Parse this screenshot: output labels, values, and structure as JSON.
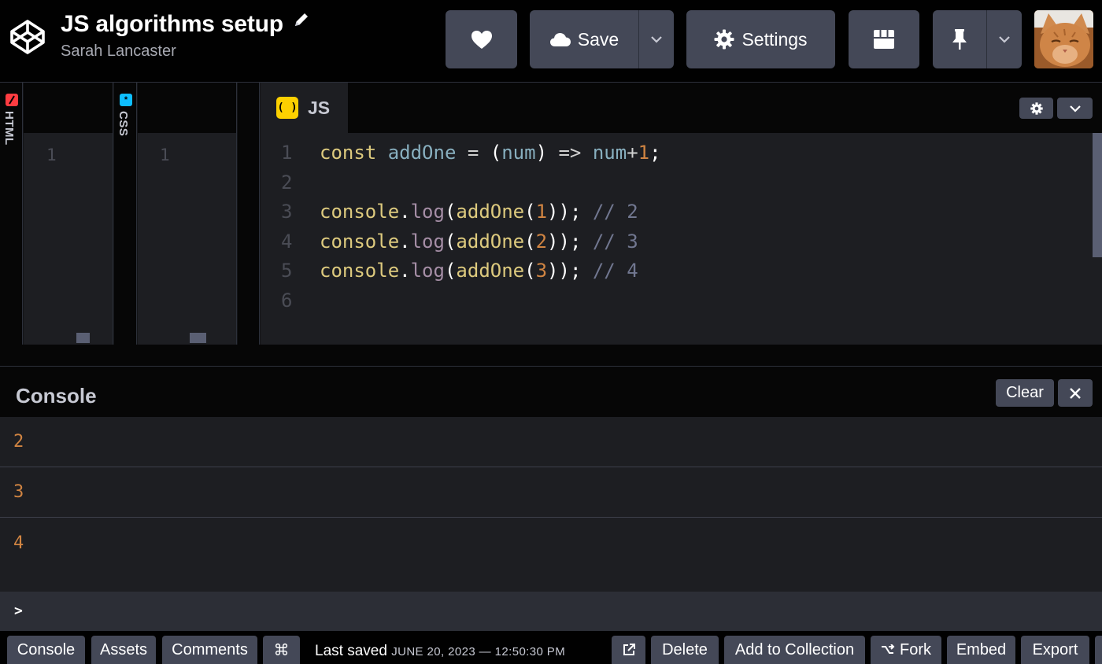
{
  "header": {
    "title": "JS algorithms setup",
    "author": "Sarah Lancaster",
    "save_label": "Save",
    "settings_label": "Settings"
  },
  "editors": {
    "html_tab_label": "HTML",
    "css_tab_label": "CSS",
    "js_tab_label": "JS",
    "html_line_number": "1",
    "css_line_number": "1",
    "js_badge": "( )",
    "code_lines": [
      {
        "n": "1",
        "text": "const addOne = (num) => num+1;"
      },
      {
        "n": "2",
        "text": ""
      },
      {
        "n": "3",
        "text": "console.log(addOne(1)); // 2"
      },
      {
        "n": "4",
        "text": "console.log(addOne(2)); // 3"
      },
      {
        "n": "5",
        "text": "console.log(addOne(3)); // 4"
      },
      {
        "n": "6",
        "text": ""
      }
    ]
  },
  "console": {
    "title": "Console",
    "clear_label": "Clear",
    "output": [
      "2",
      "3",
      "4"
    ],
    "prompt": ">"
  },
  "footer": {
    "console_label": "Console",
    "assets_label": "Assets",
    "comments_label": "Comments",
    "shortcut_label": "⌘",
    "last_saved_label": "Last saved",
    "last_saved_date": "JUNE 20, 2023 — 12:50:30 PM",
    "delete_label": "Delete",
    "add_collection_label": "Add to Collection",
    "fork_label": "Fork",
    "embed_label": "Embed",
    "export_label": "Export"
  },
  "icons": {
    "logo": "codepen-logo-icon",
    "edit": "pencil-icon",
    "heart": "heart-icon",
    "cloud": "cloud-icon",
    "gear": "gear-icon",
    "layout": "layout-icon",
    "pin": "pin-icon",
    "caret": "chevron-down-icon",
    "close": "close-icon",
    "external": "external-link-icon",
    "fork": "fork-icon"
  },
  "colors": {
    "accent_js": "#fcd000",
    "accent_html": "#ff3c41",
    "accent_css": "#0ebeff",
    "button_bg": "#444857",
    "console_output": "#d08442"
  }
}
